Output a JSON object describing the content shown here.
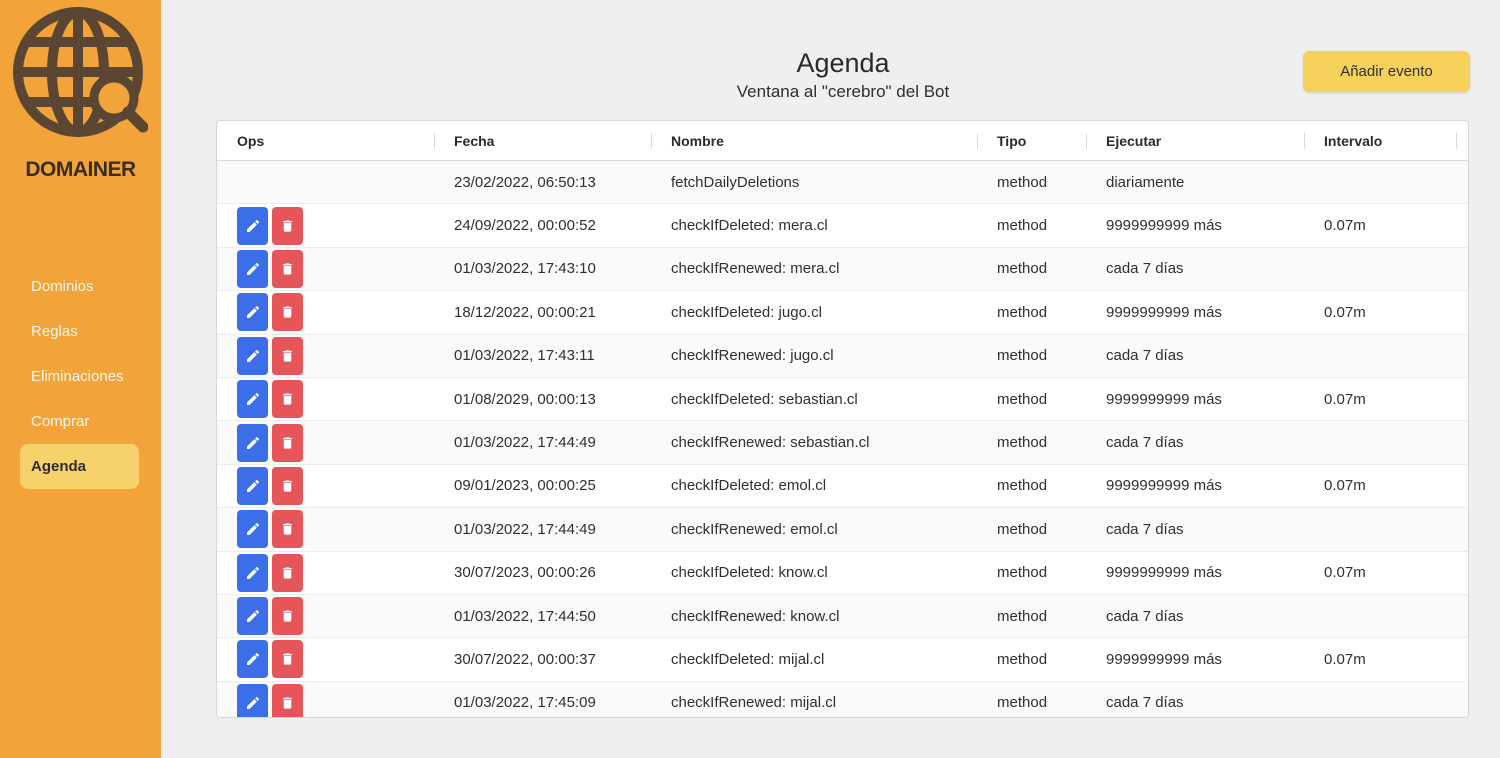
{
  "sidebar": {
    "brand": "DOMAINER",
    "items": [
      {
        "label": "Dominios",
        "active": false
      },
      {
        "label": "Reglas",
        "active": false
      },
      {
        "label": "Eliminaciones",
        "active": false
      },
      {
        "label": "Comprar",
        "active": false
      },
      {
        "label": "Agenda",
        "active": true
      }
    ]
  },
  "header": {
    "title": "Agenda",
    "subtitle": "Ventana al \"cerebro\" del Bot",
    "add_button": "Añadir evento"
  },
  "table": {
    "columns": [
      "Ops",
      "Fecha",
      "Nombre",
      "Tipo",
      "Ejecutar",
      "Intervalo"
    ],
    "rows": [
      {
        "has_ops": false,
        "fecha": "23/02/2022, 06:50:13",
        "nombre": "fetchDailyDeletions",
        "tipo": "method",
        "ejecutar": "diariamente",
        "intervalo": ""
      },
      {
        "has_ops": true,
        "fecha": "24/09/2022, 00:00:52",
        "nombre": "checkIfDeleted: mera.cl",
        "tipo": "method",
        "ejecutar": "9999999999 más",
        "intervalo": "0.07m"
      },
      {
        "has_ops": true,
        "fecha": "01/03/2022, 17:43:10",
        "nombre": "checkIfRenewed: mera.cl",
        "tipo": "method",
        "ejecutar": "cada 7 días",
        "intervalo": ""
      },
      {
        "has_ops": true,
        "fecha": "18/12/2022, 00:00:21",
        "nombre": "checkIfDeleted: jugo.cl",
        "tipo": "method",
        "ejecutar": "9999999999 más",
        "intervalo": "0.07m"
      },
      {
        "has_ops": true,
        "fecha": "01/03/2022, 17:43:11",
        "nombre": "checkIfRenewed: jugo.cl",
        "tipo": "method",
        "ejecutar": "cada 7 días",
        "intervalo": ""
      },
      {
        "has_ops": true,
        "fecha": "01/08/2029, 00:00:13",
        "nombre": "checkIfDeleted: sebastian.cl",
        "tipo": "method",
        "ejecutar": "9999999999 más",
        "intervalo": "0.07m"
      },
      {
        "has_ops": true,
        "fecha": "01/03/2022, 17:44:49",
        "nombre": "checkIfRenewed: sebastian.cl",
        "tipo": "method",
        "ejecutar": "cada 7 días",
        "intervalo": ""
      },
      {
        "has_ops": true,
        "fecha": "09/01/2023, 00:00:25",
        "nombre": "checkIfDeleted: emol.cl",
        "tipo": "method",
        "ejecutar": "9999999999 más",
        "intervalo": "0.07m"
      },
      {
        "has_ops": true,
        "fecha": "01/03/2022, 17:44:49",
        "nombre": "checkIfRenewed: emol.cl",
        "tipo": "method",
        "ejecutar": "cada 7 días",
        "intervalo": ""
      },
      {
        "has_ops": true,
        "fecha": "30/07/2023, 00:00:26",
        "nombre": "checkIfDeleted: know.cl",
        "tipo": "method",
        "ejecutar": "9999999999 más",
        "intervalo": "0.07m"
      },
      {
        "has_ops": true,
        "fecha": "01/03/2022, 17:44:50",
        "nombre": "checkIfRenewed: know.cl",
        "tipo": "method",
        "ejecutar": "cada 7 días",
        "intervalo": ""
      },
      {
        "has_ops": true,
        "fecha": "30/07/2022, 00:00:37",
        "nombre": "checkIfDeleted: mijal.cl",
        "tipo": "method",
        "ejecutar": "9999999999 más",
        "intervalo": "0.07m"
      },
      {
        "has_ops": true,
        "fecha": "01/03/2022, 17:45:09",
        "nombre": "checkIfRenewed: mijal.cl",
        "tipo": "method",
        "ejecutar": "cada 7 días",
        "intervalo": ""
      }
    ]
  },
  "icons": {
    "logo": "globe-search-icon",
    "edit": "pencil-icon",
    "delete": "trash-icon"
  },
  "colors": {
    "sidebar": "#f2a33a",
    "active_nav": "#f7d16a",
    "add_button": "#f6d25c",
    "edit_button": "#3b6ee8",
    "delete_button": "#e5555a"
  }
}
